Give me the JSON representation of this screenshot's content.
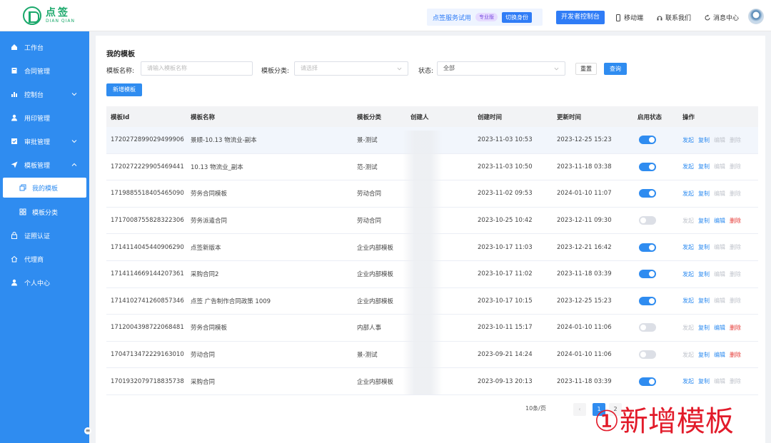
{
  "brand": {
    "name": "点签",
    "sub": "DIAN QIAN",
    "accent": "#1aa86b"
  },
  "header": {
    "trial_text": "点签服务试用",
    "trial_badge": "专业版",
    "switch_label": "切换身份",
    "dev_button": "开发者控制台",
    "links": [
      {
        "icon": "phone-icon",
        "label": "移动端"
      },
      {
        "icon": "headset-icon",
        "label": "联系我们"
      },
      {
        "icon": "refresh-icon",
        "label": "消息中心"
      }
    ]
  },
  "sidebar": {
    "color": "#2f8cf0",
    "items": [
      {
        "icon": "home-icon",
        "label": "工作台"
      },
      {
        "icon": "contract-icon",
        "label": "合同管理"
      },
      {
        "icon": "chart-icon",
        "label": "控制台"
      },
      {
        "icon": "user-icon",
        "label": "用印管理"
      },
      {
        "icon": "checkbox-icon",
        "label": "审批管理"
      },
      {
        "icon": "send-icon",
        "label": "模板管理"
      },
      {
        "icon": "copy-icon",
        "label": "我的模板"
      },
      {
        "icon": "grid-icon",
        "label": "模板分类"
      },
      {
        "icon": "lock-icon",
        "label": "证照认证"
      },
      {
        "icon": "home-outline-icon",
        "label": "代理商"
      },
      {
        "icon": "person-icon",
        "label": "个人中心"
      }
    ]
  },
  "main": {
    "title": "我的模板",
    "filters": {
      "name_label": "模板名称:",
      "name_placeholder": "请输入模板名称",
      "category_label": "模板分类:",
      "category_placeholder": "请选择",
      "status_label": "状态:",
      "status_value": "全部"
    },
    "reset_label": "重置",
    "query_label": "查询",
    "add_label": "新增模板",
    "columns": [
      "模板Id",
      "模板名称",
      "模板分类",
      "创建人",
      "创建时间",
      "更新时间",
      "启用状态",
      "操作"
    ],
    "actions": [
      "发起",
      "复制",
      "编辑",
      "删除"
    ],
    "rows": [
      {
        "id": "1720272899029499906",
        "name": "景顺-10.13 物流业-副本",
        "category": "景-测试",
        "creator": "",
        "created": "2023-11-03 10:53",
        "updated": "2023-12-25 15:23",
        "enabled": true
      },
      {
        "id": "1720272229905469441",
        "name": "10.13 物流业_副本",
        "category": "范-测试",
        "creator": "",
        "created": "2023-11-03 10:50",
        "updated": "2023-11-18 03:38",
        "enabled": true
      },
      {
        "id": "1719885518405465090",
        "name": "劳务合同模板",
        "category": "劳动合同",
        "creator": "",
        "created": "2023-11-02 09:53",
        "updated": "2024-01-10 11:07",
        "enabled": true
      },
      {
        "id": "1717008755828322306",
        "name": "劳务派遣合同",
        "category": "劳动合同",
        "creator": "",
        "created": "2023-10-25 10:42",
        "updated": "2023-12-11 09:30",
        "enabled": false
      },
      {
        "id": "1714114045440906290",
        "name": "点签新版本",
        "category": "企业内部模板",
        "creator": "",
        "created": "2023-10-17 11:03",
        "updated": "2023-12-21 16:42",
        "enabled": true
      },
      {
        "id": "1714114669144207361",
        "name": "采购合同2",
        "category": "企业内部模板",
        "creator": "",
        "created": "2023-10-17 11:02",
        "updated": "2023-11-18 03:39",
        "enabled": true
      },
      {
        "id": "1714102741260857346",
        "name": "点签 广告制作合同政策 1009",
        "category": "企业内部模板",
        "creator": "",
        "created": "2023-10-17 10:15",
        "updated": "2023-12-25 15:23",
        "enabled": true
      },
      {
        "id": "1712004398722068481",
        "name": "劳务合同模板",
        "category": "内部人事",
        "creator": "",
        "created": "2023-10-11 15:17",
        "updated": "2024-01-10 11:06",
        "enabled": false
      },
      {
        "id": "1704713472229163010",
        "name": "劳动合同",
        "category": "景-测试",
        "creator": "",
        "created": "2023-09-21 14:24",
        "updated": "2024-01-10 11:06",
        "enabled": false
      },
      {
        "id": "1701932079718835738",
        "name": "采购合同",
        "category": "企业内部模板",
        "creator": "",
        "created": "2023-09-13 20:13",
        "updated": "2023-11-18 03:39",
        "enabled": true
      }
    ],
    "row_actions": [
      [
        "blue",
        "blue",
        "grey",
        "grey"
      ],
      [
        "blue",
        "blue",
        "grey",
        "grey"
      ],
      [
        "blue",
        "blue",
        "grey",
        "grey"
      ],
      [
        "grey",
        "blue",
        "blue",
        "red"
      ],
      [
        "blue",
        "blue",
        "grey",
        "grey"
      ],
      [
        "blue",
        "blue",
        "grey",
        "grey"
      ],
      [
        "blue",
        "blue",
        "grey",
        "grey"
      ],
      [
        "grey",
        "blue",
        "blue",
        "red"
      ],
      [
        "grey",
        "blue",
        "blue",
        "red"
      ],
      [
        "blue",
        "blue",
        "grey",
        "grey"
      ]
    ],
    "pagination": {
      "page_size": "10条/页",
      "current": "1",
      "next": "2"
    }
  },
  "overlay_caption": "①新增模板"
}
